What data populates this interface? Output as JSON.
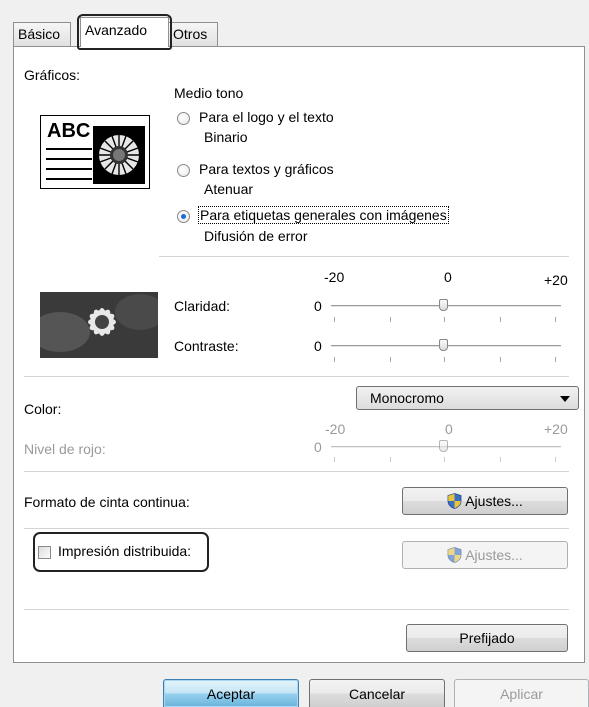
{
  "tabs": [
    {
      "label": "Básico"
    },
    {
      "label": "Avanzado"
    },
    {
      "label": "Otros"
    }
  ],
  "graphics": {
    "label": "Gráficos:",
    "sample_text": "ABC",
    "halftone_label": "Medio tono",
    "options": [
      {
        "label": "Para el logo y el texto",
        "sub": "Binario",
        "checked": false
      },
      {
        "label": "Para textos y gráficos",
        "sub": "Atenuar",
        "checked": false
      },
      {
        "label": "Para etiquetas generales con imágenes",
        "sub": "Difusión de error",
        "checked": true
      }
    ]
  },
  "adjust": {
    "scale_min": "-20",
    "scale_mid": "0",
    "scale_max": "+20",
    "brightness_label": "Claridad:",
    "brightness_value": "0",
    "contrast_label": "Contraste:",
    "contrast_value": "0"
  },
  "color": {
    "label": "Color:",
    "selected": "Monocromo",
    "red_level_label": "Nivel de rojo:",
    "red_min": "-20",
    "red_mid": "0",
    "red_max": "+20",
    "red_value": "0"
  },
  "continuous_tape": {
    "label": "Formato de cinta continua:",
    "button": "Ajustes..."
  },
  "distributed": {
    "label": "Impresión distribuida:",
    "checked": false,
    "button": "Ajustes..."
  },
  "default_button": "Prefijado",
  "footer": {
    "ok": "Aceptar",
    "cancel": "Cancelar",
    "apply": "Aplicar"
  }
}
